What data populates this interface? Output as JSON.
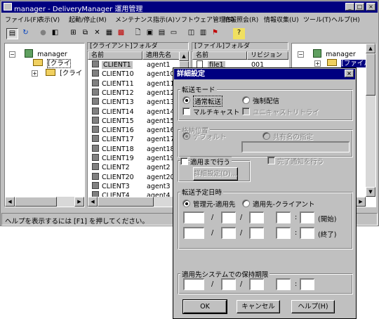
{
  "window": {
    "title": "manager - DeliveryManager 運用管理"
  },
  "menu": [
    "ファイル(F)",
    "表示(V)",
    "起動/停止(M)",
    "メンテナンス指示(A)",
    "ソフトウェア管理(S)",
    "情報照会(R)",
    "情報収集(U)",
    "ツール(T)",
    "ヘルプ(H)"
  ],
  "left_tree": {
    "root": "manager",
    "children": [
      "[クライ",
      "[クライ"
    ]
  },
  "client_pane": {
    "header": "[クライアント]フォルダ",
    "col_name": "名前",
    "col_agent": "適用先名",
    "rows": [
      {
        "name": "CLIENT1",
        "agent": "agent1"
      },
      {
        "name": "CLIENT10",
        "agent": "agent10"
      },
      {
        "name": "CLIENT11",
        "agent": "agent11"
      },
      {
        "name": "CLIENT12",
        "agent": "agent12"
      },
      {
        "name": "CLIENT13",
        "agent": "agent13"
      },
      {
        "name": "CLIENT14",
        "agent": "agent14"
      },
      {
        "name": "CLIENT15",
        "agent": "agent15"
      },
      {
        "name": "CLIENT16",
        "agent": "agent16"
      },
      {
        "name": "CLIENT17",
        "agent": "agent17"
      },
      {
        "name": "CLIENT18",
        "agent": "agent18"
      },
      {
        "name": "CLIENT19",
        "agent": "agent19"
      },
      {
        "name": "CLIENT2",
        "agent": "agent2"
      },
      {
        "name": "CLIENT20",
        "agent": "agent20"
      },
      {
        "name": "CLIENT3",
        "agent": "agent3"
      },
      {
        "name": "CLIENT4",
        "agent": "agent4"
      }
    ]
  },
  "file_pane": {
    "header": "[ファイル]フォルダ",
    "col_name": "名前",
    "col_rev": "リビジョン",
    "rows": [
      {
        "name": "file1",
        "rev": "001"
      }
    ]
  },
  "right_tree": {
    "root": "manager",
    "child": "[ファイル"
  },
  "status": "ヘルプを表示するには [F1] を押してください。",
  "dialog": {
    "title": "詳細設定",
    "transfer_mode": {
      "title": "転送モード",
      "normal": "通常転送",
      "forced": "強制配信",
      "multicast": "マルチキャスト",
      "unicast_retry": "ユニキャストリトライ"
    },
    "storage": {
      "title": "格納位置",
      "default": "デフォルト",
      "shared": "共有名の指定"
    },
    "apply_until": "適用まで行う",
    "details_button": "詳細設定(D)...",
    "notify_complete": "完了通知を行う",
    "schedule": {
      "title": "転送予定日時",
      "opt_manager": "管理元-適用先",
      "opt_client": "適用先-クライアント",
      "start": "(開始)",
      "end": "(終了)",
      "date_sep": "/",
      "time_sep": ":"
    },
    "retention": {
      "title": "適用先システムでの保持期限"
    },
    "ok": "OK",
    "cancel": "キャンセル",
    "help": "ヘルプ(H)"
  }
}
